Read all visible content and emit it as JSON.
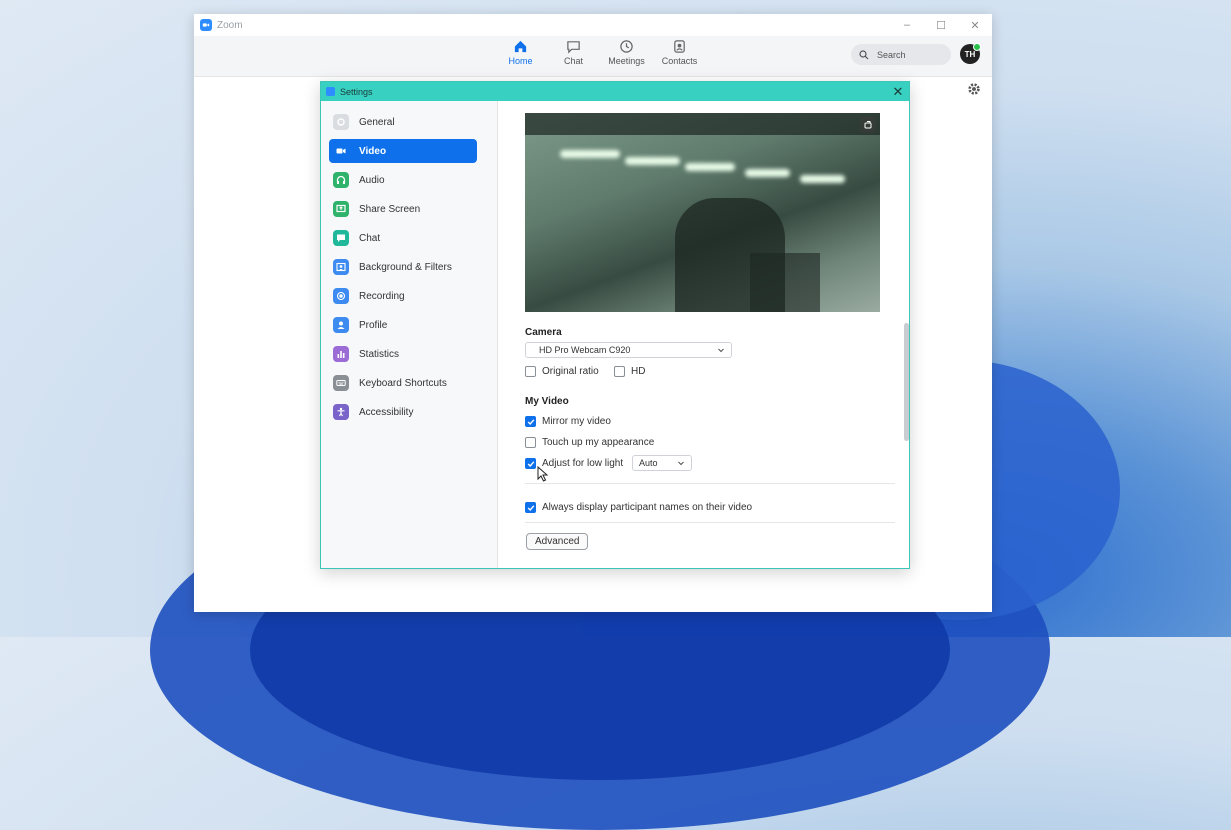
{
  "window": {
    "title": "Zoom"
  },
  "window_controls": {
    "minimize": "–",
    "maximize": "☐",
    "close": "✕"
  },
  "nav": {
    "tabs": [
      {
        "label": "Home",
        "icon": "home-icon",
        "active": true
      },
      {
        "label": "Chat",
        "icon": "chat-icon",
        "active": false
      },
      {
        "label": "Meetings",
        "icon": "clock-icon",
        "active": false
      },
      {
        "label": "Contacts",
        "icon": "contacts-icon",
        "active": false
      }
    ],
    "search_placeholder": "Search",
    "avatar_initials": "TH"
  },
  "settings": {
    "title": "Settings",
    "close": "✕",
    "sidebar": [
      {
        "label": "General",
        "icon": "gear-icon",
        "color": "#d9dce0",
        "active": false
      },
      {
        "label": "Video",
        "icon": "video-camera-icon",
        "color": "#0e71eb",
        "active": true
      },
      {
        "label": "Audio",
        "icon": "headphones-icon",
        "color": "#2fb36a",
        "active": false
      },
      {
        "label": "Share Screen",
        "icon": "share-screen-icon",
        "color": "#2fb36a",
        "active": false
      },
      {
        "label": "Chat",
        "icon": "chat-bubble-icon",
        "color": "#1fb89a",
        "active": false
      },
      {
        "label": "Background & Filters",
        "icon": "background-icon",
        "color": "#3d8af0",
        "active": false
      },
      {
        "label": "Recording",
        "icon": "recording-icon",
        "color": "#3d8af0",
        "active": false
      },
      {
        "label": "Profile",
        "icon": "profile-icon",
        "color": "#3d8af0",
        "active": false
      },
      {
        "label": "Statistics",
        "icon": "statistics-icon",
        "color": "#9b6bd6",
        "active": false
      },
      {
        "label": "Keyboard Shortcuts",
        "icon": "keyboard-icon",
        "color": "#8a8f96",
        "active": false
      },
      {
        "label": "Accessibility",
        "icon": "accessibility-icon",
        "color": "#7a63c9",
        "active": false
      }
    ],
    "video": {
      "camera_label": "Camera",
      "camera_value": "HD Pro Webcam C920",
      "original_ratio": {
        "label": "Original ratio",
        "checked": false
      },
      "hd": {
        "label": "HD",
        "checked": false
      },
      "my_video_label": "My Video",
      "mirror": {
        "label": "Mirror my video",
        "checked": true
      },
      "touch_up": {
        "label": "Touch up my appearance",
        "checked": false
      },
      "low_light": {
        "label": "Adjust for low light",
        "checked": true,
        "mode": "Auto"
      },
      "display_names": {
        "label": "Always display participant names on their video",
        "checked": true
      },
      "advanced_label": "Advanced"
    }
  },
  "colors": {
    "accent": "#0e71eb",
    "settings_header": "#37d0c1"
  }
}
